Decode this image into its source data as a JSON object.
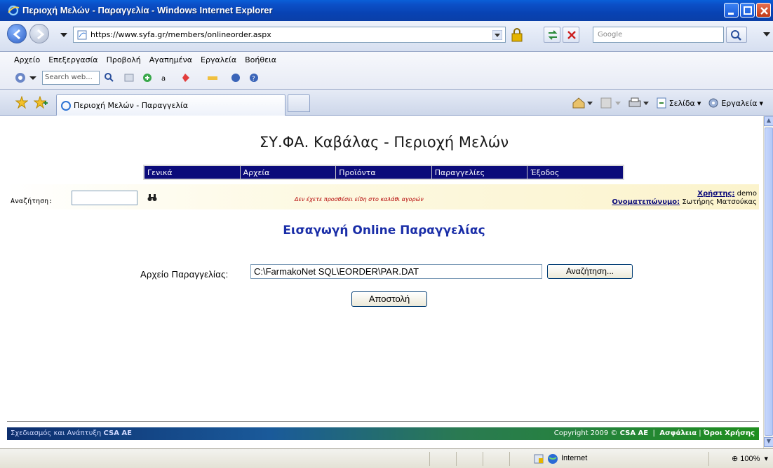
{
  "window": {
    "title": "Περιοχή Μελών - Παραγγελία - Windows Internet Explorer"
  },
  "address_bar": {
    "url": "https://www.syfa.gr/members/onlineorder.aspx",
    "search_placeholder": "Google"
  },
  "menu": {
    "items": [
      "Αρχείο",
      "Επεξεργασία",
      "Προβολή",
      "Αγαπημένα",
      "Εργαλεία",
      "Βοήθεια"
    ]
  },
  "toolbar": {
    "web_search_placeholder": "Search web..."
  },
  "tabs": {
    "active_tab_label": "Περιοχή Μελών - Παραγγελία",
    "page_label": "Σελίδα",
    "tools_label": "Εργαλεία"
  },
  "site": {
    "title": "ΣΥ.ΦΑ. Καβάλας - Περιοχή Μελών",
    "nav": [
      "Γενικά",
      "Αρχεία",
      "Προϊόντα",
      "Παραγγελίες",
      "Έξοδος"
    ],
    "search_label": "Αναζήτηση:",
    "cart_message": "Δεν έχετε προσθέσει είδη στο καλάθι αγορών",
    "user": {
      "user_label": "Χρήστης:",
      "user_value": "demo",
      "name_label": "Ονοματεπώνυμο:",
      "name_value": "Σωτήρης Ματσούκας"
    },
    "heading": "Εισαγωγή Online Παραγγελίας",
    "file_label": "Αρχείο Παραγγελίας:",
    "file_value": "C:\\FarmakoNet SQL\\EORDER\\PAR.DAT",
    "browse_label": "Αναζήτηση...",
    "send_label": "Αποστολή",
    "footer": {
      "left_text": "Σχεδιασμός και Ανάπτυξη",
      "left_brand": "CSA AE",
      "copyright": "Copyright 2009 ©",
      "copyright_brand": "CSA AE",
      "security": "Ασφάλεια",
      "terms": "Όροι Χρήσης"
    }
  },
  "status_bar": {
    "zone": "Internet",
    "zoom": "100%"
  },
  "colors": {
    "nav_bg": "#0b0b7a",
    "heading": "#1a2ea8",
    "cart_msg": "#b30000"
  }
}
